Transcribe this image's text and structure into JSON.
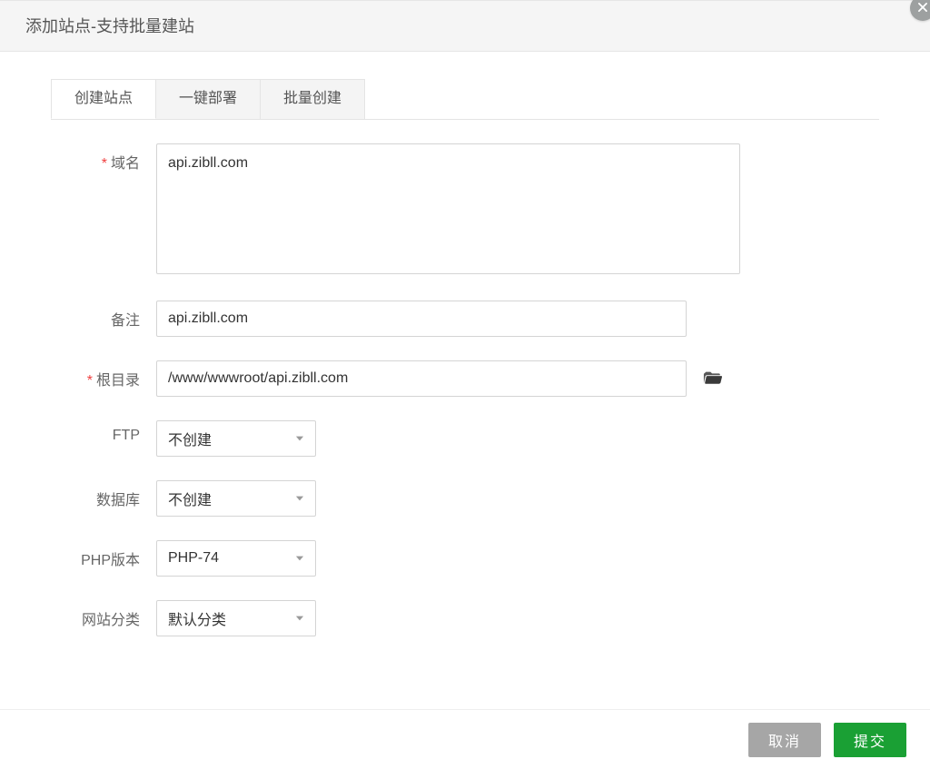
{
  "header": {
    "title": "添加站点-支持批量建站"
  },
  "tabs": [
    {
      "label": "创建站点",
      "active": true
    },
    {
      "label": "一键部署",
      "active": false
    },
    {
      "label": "批量创建",
      "active": false
    }
  ],
  "form": {
    "domain": {
      "label": "域名",
      "required": true,
      "value": "api.zibll.com"
    },
    "remark": {
      "label": "备注",
      "required": false,
      "value": "api.zibll.com"
    },
    "root": {
      "label": "根目录",
      "required": true,
      "value": "/www/wwwroot/api.zibll.com"
    },
    "ftp": {
      "label": "FTP",
      "required": false,
      "value": "不创建"
    },
    "db": {
      "label": "数据库",
      "required": false,
      "value": "不创建"
    },
    "php": {
      "label": "PHP版本",
      "required": false,
      "value": "PHP-74"
    },
    "category": {
      "label": "网站分类",
      "required": false,
      "value": "默认分类"
    }
  },
  "footer": {
    "cancel": "取消",
    "submit": "提交"
  },
  "icons": {
    "close": "close-icon",
    "folder": "folder-open-icon",
    "chevron": "chevron-down-icon"
  }
}
